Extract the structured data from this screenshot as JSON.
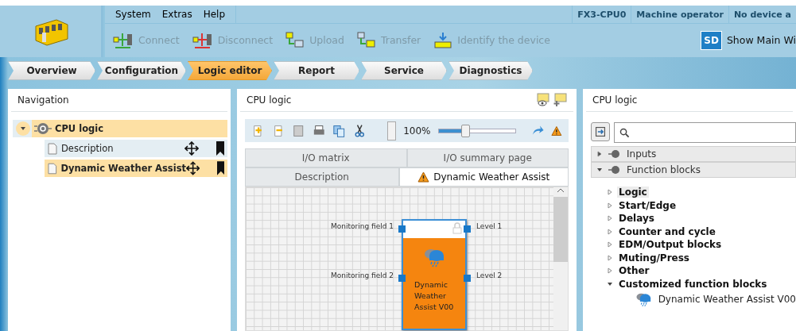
{
  "menu": [
    {
      "label": "System"
    },
    {
      "label": "Extras"
    },
    {
      "label": "Help"
    }
  ],
  "status": [
    {
      "label": "FX3-CPU0"
    },
    {
      "label": "Machine operator"
    },
    {
      "label": "No device a"
    }
  ],
  "toolbar": [
    {
      "label": "Connect",
      "kind": "connect",
      "disabled": true
    },
    {
      "label": "Disconnect",
      "kind": "disconnect",
      "disabled": true
    },
    {
      "label": "Upload",
      "kind": "upload",
      "disabled": true
    },
    {
      "label": "Transfer",
      "kind": "transfer",
      "disabled": true
    },
    {
      "label": "Identify the device",
      "kind": "identify",
      "disabled": true
    }
  ],
  "main_window_button": {
    "label": "Show Main Wi",
    "icon_text": "SD"
  },
  "tabs": [
    {
      "label": "Overview",
      "selected": false
    },
    {
      "label": "Configuration",
      "selected": false
    },
    {
      "label": "Logic editor",
      "selected": true
    },
    {
      "label": "Report",
      "selected": false
    },
    {
      "label": "Service",
      "selected": false
    },
    {
      "label": "Diagnostics",
      "selected": false
    }
  ],
  "navigation": {
    "title": "Navigation",
    "tree": {
      "label": "CPU logic",
      "expanded": true,
      "selected": true,
      "children": [
        {
          "label": "Description",
          "selected": false
        },
        {
          "label": "Dynamic Weather Assist",
          "selected": true
        }
      ]
    }
  },
  "editor": {
    "title": "CPU logic",
    "zoom": {
      "reading": "100%",
      "level": 0.35
    },
    "tab_rows": [
      [
        {
          "label": "I/O matrix",
          "selected": false,
          "warning": false
        },
        {
          "label": "I/O summary page",
          "selected": false,
          "warning": false
        }
      ],
      [
        {
          "label": "Description",
          "selected": false,
          "warning": false
        },
        {
          "label": "Dynamic Weather Assist",
          "selected": true,
          "warning": true
        }
      ]
    ],
    "block": {
      "title": "Dynamic Weather Assist V00",
      "locked": true,
      "inputs": [
        {
          "label": "Monitoring field 1"
        },
        {
          "label": "Monitoring field 2"
        }
      ],
      "outputs": [
        {
          "label": "Level 1"
        },
        {
          "label": "Level 2"
        }
      ]
    }
  },
  "library": {
    "title": "CPU logic",
    "sections": [
      {
        "label": "Inputs",
        "expanded": false
      },
      {
        "label": "Function blocks",
        "expanded": true
      }
    ],
    "categories": [
      {
        "label": "Logic",
        "expanded": false,
        "selected": true
      },
      {
        "label": "Start/Edge",
        "expanded": false,
        "selected": false
      },
      {
        "label": "Delays",
        "expanded": false,
        "selected": false
      },
      {
        "label": "Counter and cycle",
        "expanded": false,
        "selected": false
      },
      {
        "label": "EDM/Output blocks",
        "expanded": false,
        "selected": false
      },
      {
        "label": "Muting/Press",
        "expanded": false,
        "selected": false
      },
      {
        "label": "Other",
        "expanded": false,
        "selected": false
      },
      {
        "label": "Customized function blocks",
        "expanded": true,
        "selected": false,
        "children": [
          {
            "label": "Dynamic Weather Assist V00"
          }
        ]
      }
    ]
  }
}
